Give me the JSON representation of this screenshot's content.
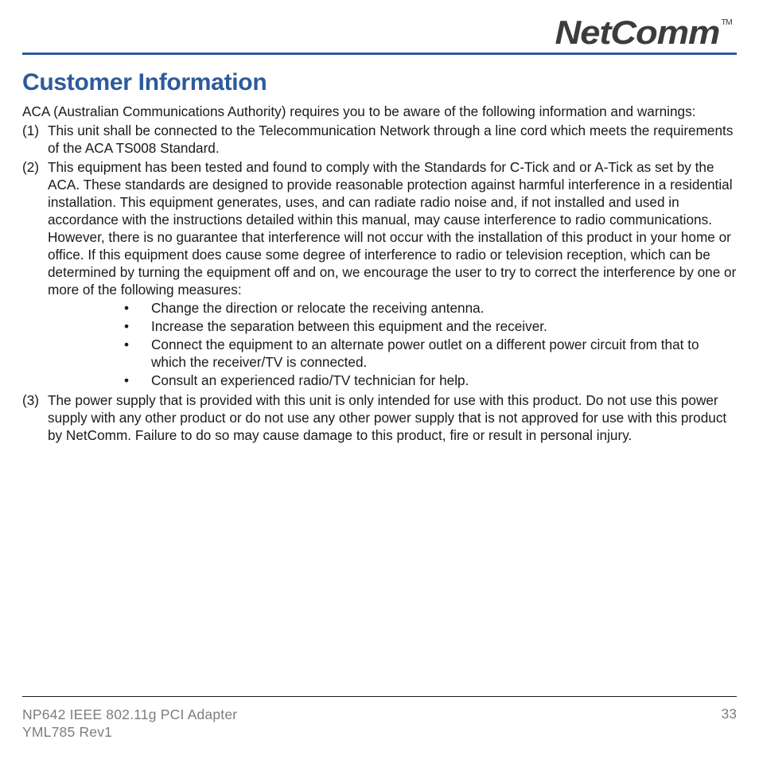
{
  "header": {
    "logo_text": "NetComm",
    "logo_tm": "TM"
  },
  "section": {
    "title": "Customer Information",
    "intro": "ACA (Australian Communications Authority) requires you to be aware of the following information and warnings:",
    "items": [
      {
        "num": "(1)",
        "text": "This unit shall be connected to the Telecommunication Network through a line cord which meets the requirements of the ACA TS008 Standard."
      },
      {
        "num": "(2)",
        "text": "This equipment has been tested and found to comply with the Standards for C-Tick and or A-Tick as set by the ACA. These standards are designed to provide reasonable protection against harmful interference in a residential installation. This equipment generates, uses, and can radiate radio noise and, if not installed and used in accordance with the instructions detailed within this manual, may cause interference to radio communications. However, there is no guarantee that interference will not occur with the installation of this product in your home or office. If this equipment does cause some degree of interference to radio or television reception, which can be determined by turning the equipment off and on, we encourage the user to try to correct the interference by one or more of the following measures:",
        "bullets": [
          "Change the direction or relocate the receiving antenna.",
          "Increase the separation between this equipment and the receiver.",
          "Connect the equipment to an alternate power outlet on a different power circuit from that to which the receiver/TV is connected.",
          "Consult an experienced radio/TV technician for help."
        ]
      },
      {
        "num": "(3)",
        "text": "The power supply that is provided with this unit is only intended for use with this product. Do not use this power supply with any other product or do not use any other power supply that is not approved for use with this product by NetComm. Failure to do so may cause damage to this product, fire or result in personal injury."
      }
    ]
  },
  "footer": {
    "line1": "NP642 IEEE 802.11g PCI Adapter",
    "line2": "YML785 Rev1",
    "page": "33"
  }
}
